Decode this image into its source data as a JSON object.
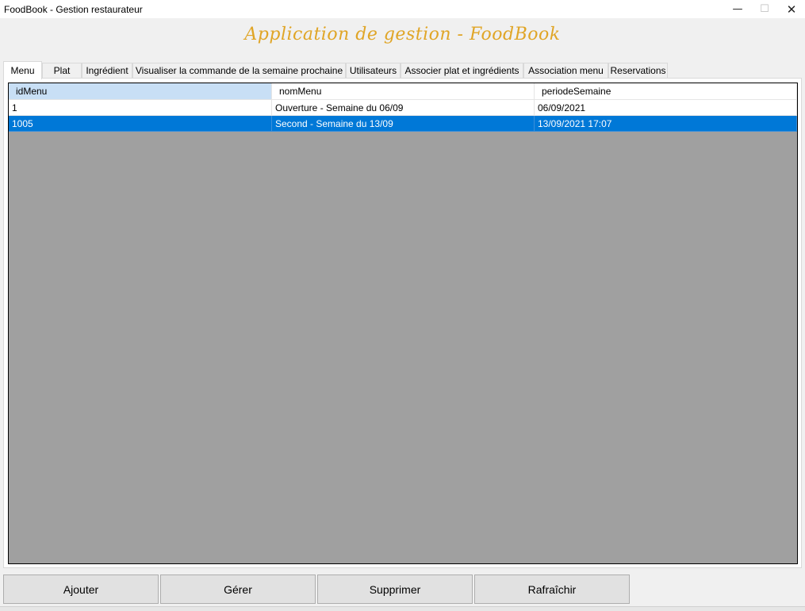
{
  "window": {
    "title": "FoodBook - Gestion restaurateur",
    "min_glyph": "—",
    "max_glyph": "☐",
    "close_glyph": "✕"
  },
  "heading": "Application de gestion - FoodBook",
  "tabs": [
    {
      "label": "Menu",
      "active": true
    },
    {
      "label": "Plat"
    },
    {
      "label": "Ingrédient"
    },
    {
      "label": "Visualiser la commande de la semaine prochaine"
    },
    {
      "label": "Utilisateurs"
    },
    {
      "label": "Associer plat et ingrédients"
    },
    {
      "label": "Association menu"
    },
    {
      "label": "Reservations"
    }
  ],
  "grid": {
    "columns": [
      "idMenu",
      "nomMenu",
      "periodeSemaine"
    ],
    "rows": [
      {
        "idMenu": "1",
        "nomMenu": "Ouverture - Semaine du 06/09",
        "periodeSemaine": "06/09/2021"
      },
      {
        "idMenu": "1005",
        "nomMenu": "Second  - Semaine du 13/09",
        "periodeSemaine": "13/09/2021 17:07",
        "selected": true
      }
    ]
  },
  "buttons": {
    "add": "Ajouter",
    "manage": "Gérer",
    "delete": "Supprimer",
    "refresh": "Rafraîchir"
  },
  "colors": {
    "heading": "#e0a526",
    "selection": "#0078d7",
    "header_selected": "#c8dff5",
    "grid_background": "#a0a0a0"
  }
}
